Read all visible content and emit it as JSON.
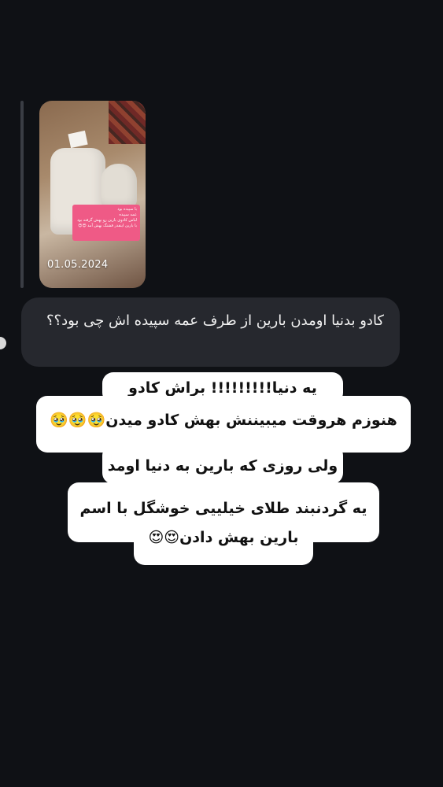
{
  "story": {
    "date": "01.05.2024",
    "sticker_lines": [
      "با سپیده بود",
      "عمه سپیده",
      "لباس کادوی بارین رو بهش گرفته بود",
      "با بارین اینقدر قشنگ بهش آمد 😍😍"
    ]
  },
  "messages": {
    "question": "کادو بدنیا اومدن بارین از طرف عمه سپیده اش چی بود؟؟",
    "answer_lines": [
      "یه دنیا!!!!!!!!! براش کادو گرفتن",
      "هنوزم هروقت میبیننش بهش کادو میدن🥹🥹🥹",
      "ولی روزی که بارین به دنیا اومد",
      "یه گردنبند طلای خیلییی خوشگل با اسم",
      "بارین بهش دادن😍😍"
    ]
  }
}
